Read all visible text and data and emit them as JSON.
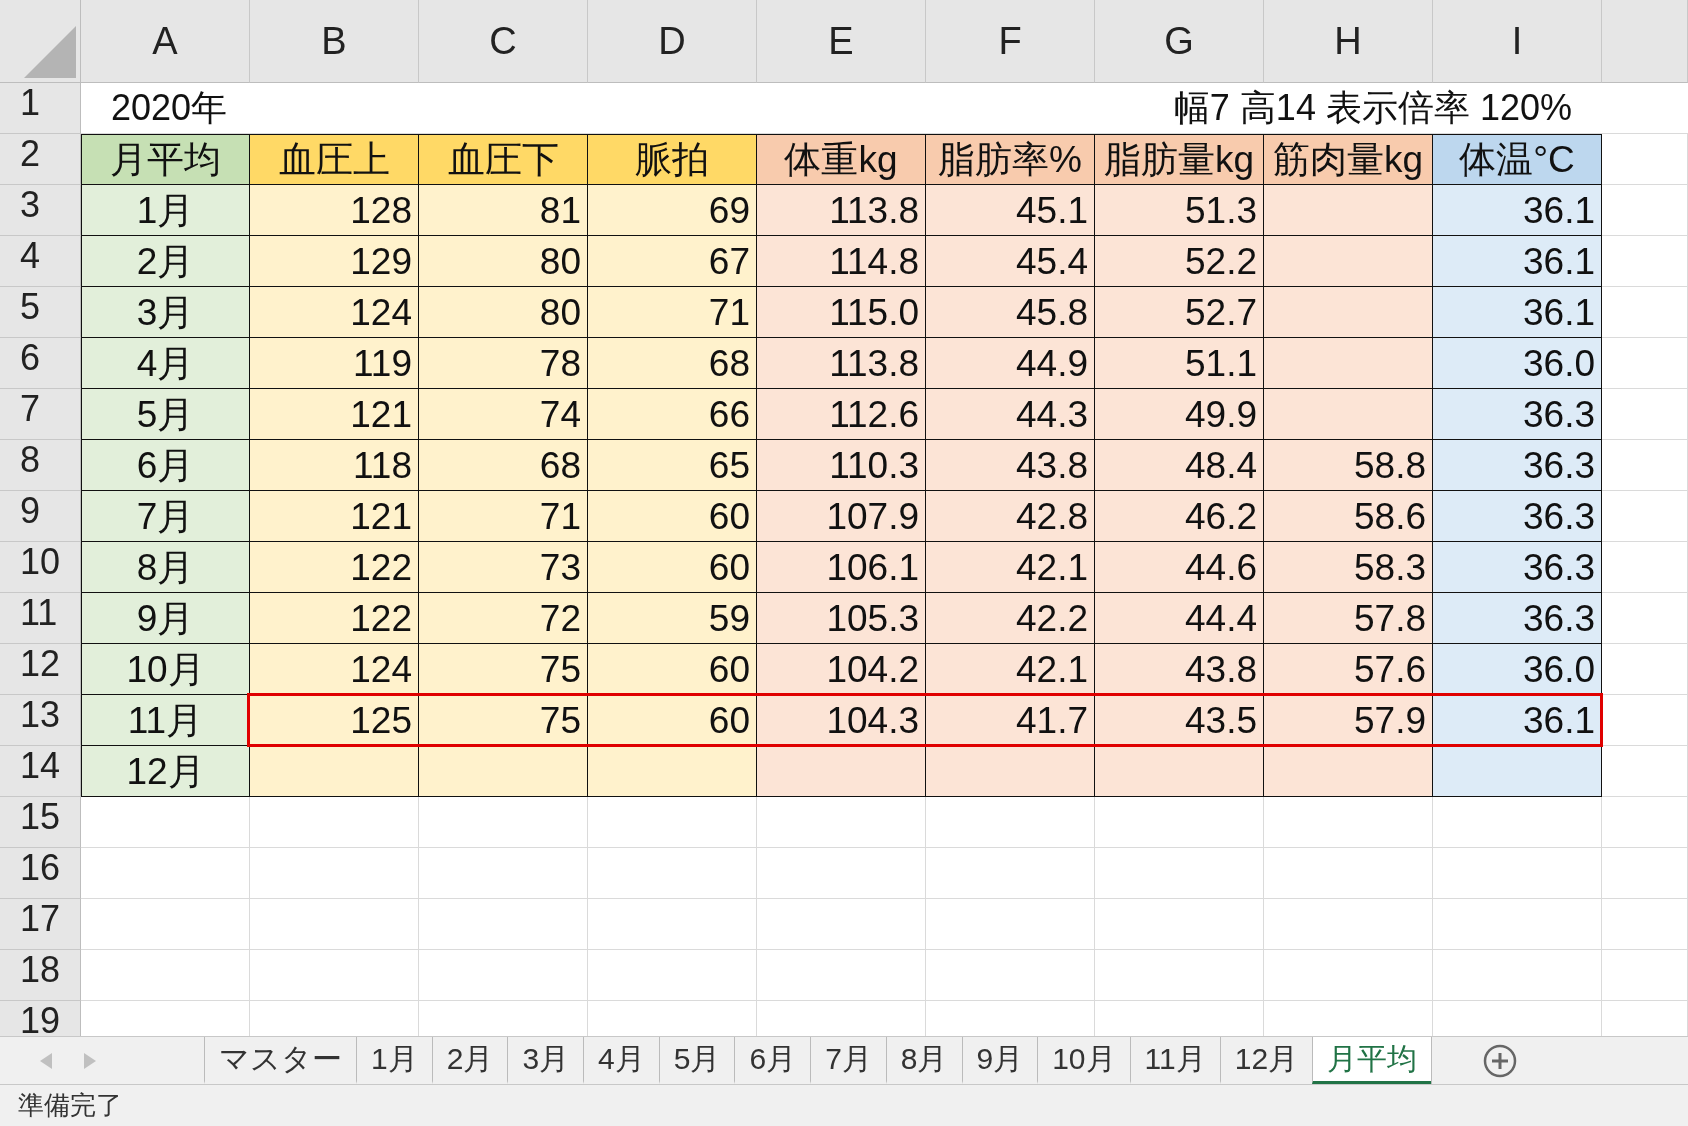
{
  "columns": [
    "A",
    "B",
    "C",
    "D",
    "E",
    "F",
    "G",
    "H",
    "I"
  ],
  "row_numbers": [
    "1",
    "2",
    "3",
    "4",
    "5",
    "6",
    "7",
    "8",
    "9",
    "10",
    "11",
    "12",
    "13",
    "14",
    "15",
    "16",
    "17",
    "18",
    "19"
  ],
  "title": "2020年",
  "note": "幅7 高14 表示倍率 120%",
  "headers": [
    {
      "label": "月平均",
      "kind": "month"
    },
    {
      "label": "血圧上",
      "kind": "vital"
    },
    {
      "label": "血圧下",
      "kind": "vital"
    },
    {
      "label": "脈拍",
      "kind": "vital"
    },
    {
      "label": "体重kg",
      "kind": "body"
    },
    {
      "label": "脂肪率%",
      "kind": "body"
    },
    {
      "label": "脂肪量kg",
      "kind": "body"
    },
    {
      "label": "筋肉量kg",
      "kind": "body"
    },
    {
      "label": "体温°C",
      "kind": "temp"
    }
  ],
  "rows": [
    {
      "cells": [
        "1月",
        "128",
        "81",
        "69",
        "113.8",
        "45.1",
        "51.3",
        null,
        "36.1"
      ],
      "highlighted": false
    },
    {
      "cells": [
        "2月",
        "129",
        "80",
        "67",
        "114.8",
        "45.4",
        "52.2",
        null,
        "36.1"
      ],
      "highlighted": false
    },
    {
      "cells": [
        "3月",
        "124",
        "80",
        "71",
        "115.0",
        "45.8",
        "52.7",
        null,
        "36.1"
      ],
      "highlighted": false
    },
    {
      "cells": [
        "4月",
        "119",
        "78",
        "68",
        "113.8",
        "44.9",
        "51.1",
        null,
        "36.0"
      ],
      "highlighted": false
    },
    {
      "cells": [
        "5月",
        "121",
        "74",
        "66",
        "112.6",
        "44.3",
        "49.9",
        null,
        "36.3"
      ],
      "highlighted": false
    },
    {
      "cells": [
        "6月",
        "118",
        "68",
        "65",
        "110.3",
        "43.8",
        "48.4",
        "58.8",
        "36.3"
      ],
      "highlighted": false
    },
    {
      "cells": [
        "7月",
        "121",
        "71",
        "60",
        "107.9",
        "42.8",
        "46.2",
        "58.6",
        "36.3"
      ],
      "highlighted": false
    },
    {
      "cells": [
        "8月",
        "122",
        "73",
        "60",
        "106.1",
        "42.1",
        "44.6",
        "58.3",
        "36.3"
      ],
      "highlighted": false
    },
    {
      "cells": [
        "9月",
        "122",
        "72",
        "59",
        "105.3",
        "42.2",
        "44.4",
        "57.8",
        "36.3"
      ],
      "highlighted": false
    },
    {
      "cells": [
        "10月",
        "124",
        "75",
        "60",
        "104.2",
        "42.1",
        "43.8",
        "57.6",
        "36.0"
      ],
      "highlighted": false
    },
    {
      "cells": [
        "11月",
        "125",
        "75",
        "60",
        "104.3",
        "41.7",
        "43.5",
        "57.9",
        "36.1"
      ],
      "highlighted": true
    },
    {
      "cells": [
        "12月",
        null,
        null,
        null,
        null,
        null,
        null,
        null,
        null
      ],
      "highlighted": false
    }
  ],
  "sheet_tabs": [
    {
      "label": "マスター",
      "selected": false
    },
    {
      "label": "1月",
      "selected": false
    },
    {
      "label": "2月",
      "selected": false
    },
    {
      "label": "3月",
      "selected": false
    },
    {
      "label": "4月",
      "selected": false
    },
    {
      "label": "5月",
      "selected": false
    },
    {
      "label": "6月",
      "selected": false
    },
    {
      "label": "7月",
      "selected": false
    },
    {
      "label": "8月",
      "selected": false
    },
    {
      "label": "9月",
      "selected": false
    },
    {
      "label": "10月",
      "selected": false
    },
    {
      "label": "11月",
      "selected": false
    },
    {
      "label": "12月",
      "selected": false
    },
    {
      "label": "月平均",
      "selected": true
    }
  ],
  "status_bar": "準備完了"
}
